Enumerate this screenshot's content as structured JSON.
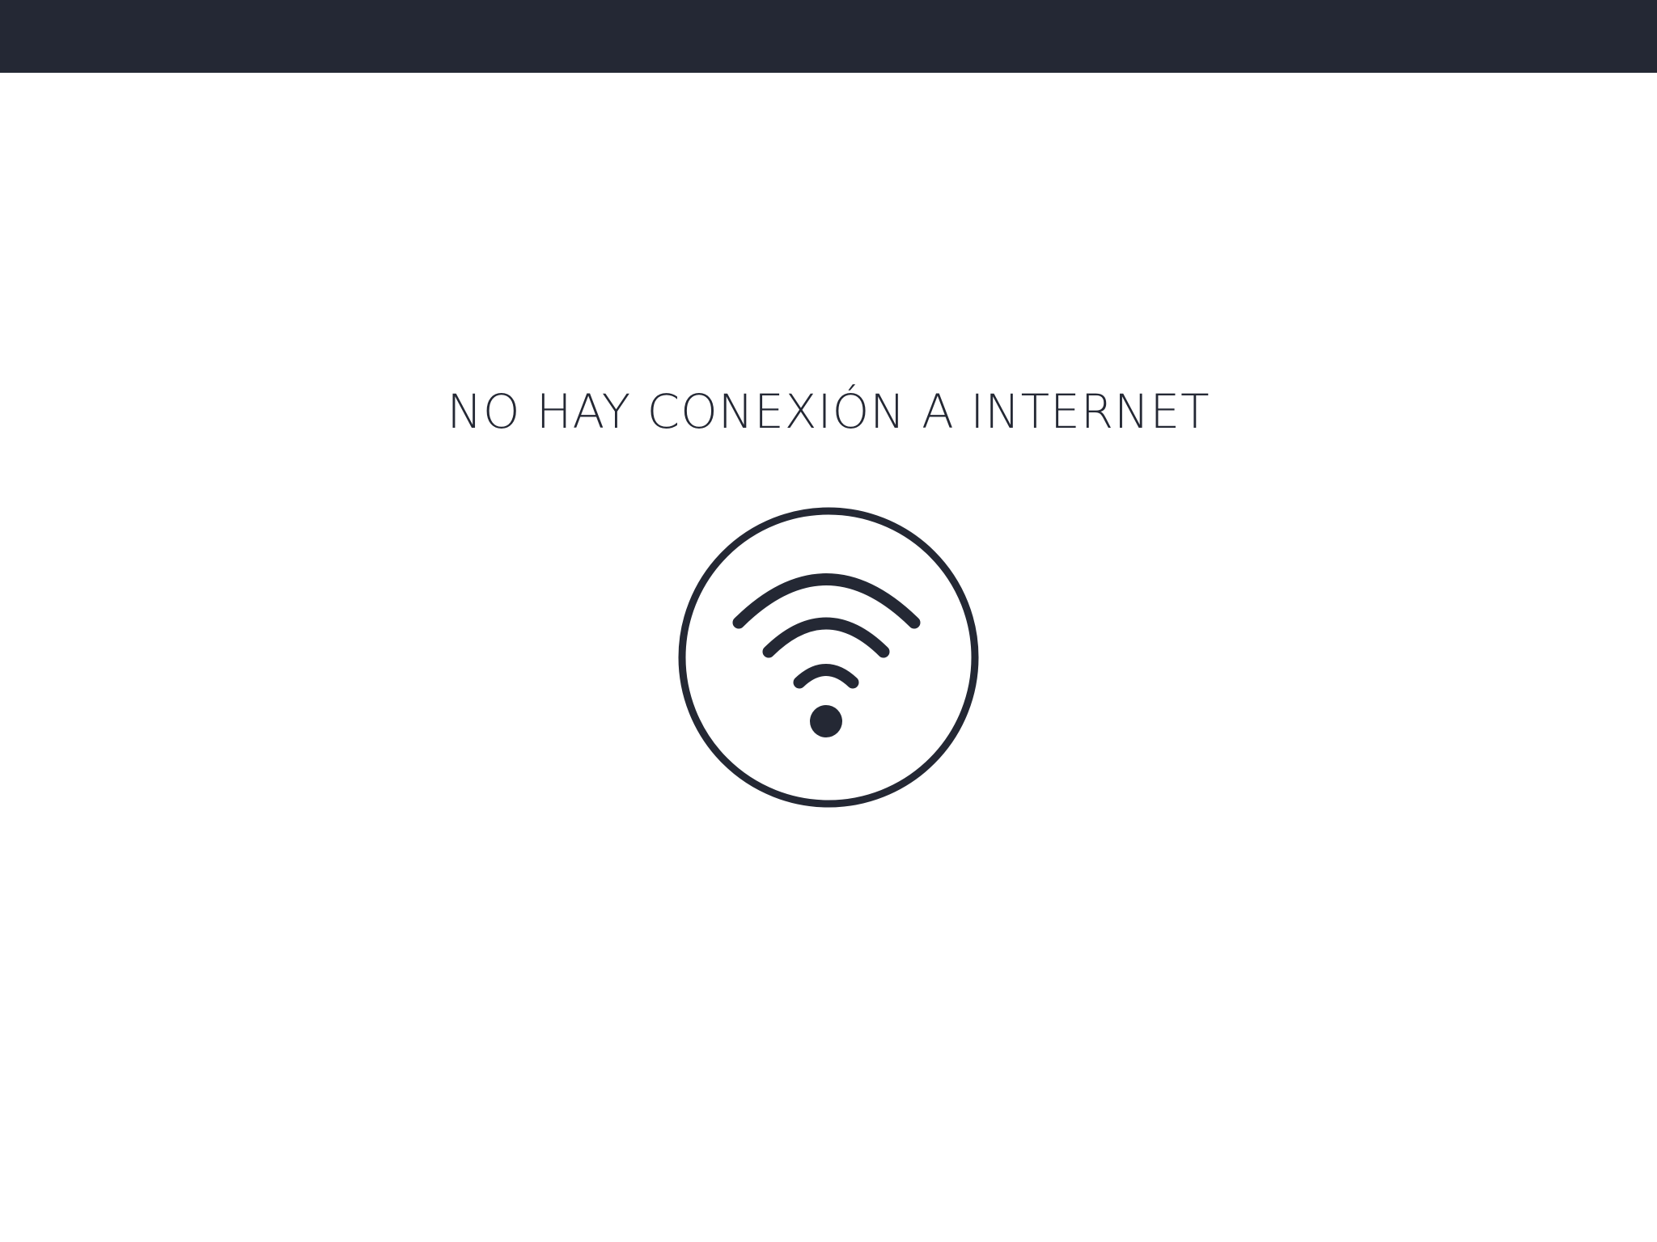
{
  "header": {
    "bar_color": "#242834"
  },
  "offline": {
    "message": "NO HAY CONEXIÓN A INTERNET",
    "icon": "wifi-icon",
    "icon_color": "#242834"
  }
}
